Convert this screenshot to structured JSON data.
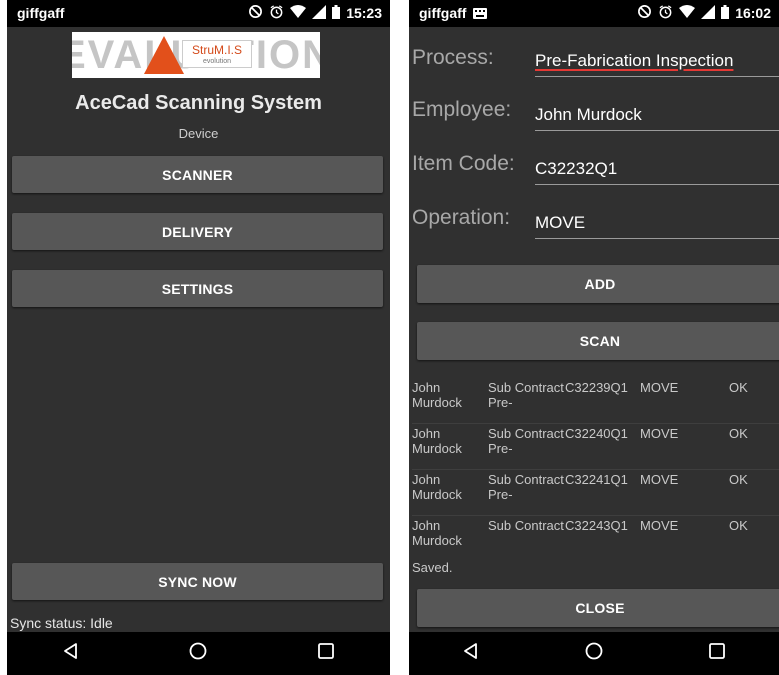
{
  "left": {
    "status": {
      "carrier": "giffgaff",
      "time": "15:23"
    },
    "logo": {
      "word": "EVALUATION",
      "brand": "StruM.I.S",
      "brand_sub": "evolution"
    },
    "title": "AceCad Scanning System",
    "device_label": "Device",
    "buttons": {
      "scanner": "SCANNER",
      "delivery": "DELIVERY",
      "settings": "SETTINGS",
      "sync": "SYNC NOW"
    },
    "sync_status": "Sync status: Idle"
  },
  "right": {
    "status": {
      "carrier": "giffgaff",
      "time": "16:02"
    },
    "form": {
      "process": {
        "label": "Process:",
        "value": "Pre-Fabrication Inspection"
      },
      "employee": {
        "label": "Employee:",
        "value": "John Murdock"
      },
      "item_code": {
        "label": "Item Code:",
        "value": "C32232Q1"
      },
      "operation": {
        "label": "Operation:",
        "value": "MOVE"
      }
    },
    "buttons": {
      "add": "ADD",
      "scan": "SCAN",
      "close": "CLOSE"
    },
    "log": [
      {
        "employee": "John Murdock",
        "process": "Sub Contract Pre-",
        "code": "C32239Q1",
        "op": "MOVE",
        "result": "OK"
      },
      {
        "employee": "John Murdock",
        "process": "Sub Contract Pre-",
        "code": "C32240Q1",
        "op": "MOVE",
        "result": "OK"
      },
      {
        "employee": "John Murdock",
        "process": "Sub Contract Pre-",
        "code": "C32241Q1",
        "op": "MOVE",
        "result": "OK"
      },
      {
        "employee": "John Murdock",
        "process": "Sub Contract",
        "code": "C32243Q1",
        "op": "MOVE",
        "result": "OK"
      }
    ],
    "saved_text": "Saved."
  },
  "icons": [
    "do-not-disturb-icon",
    "alarm-icon",
    "wifi-icon",
    "signal-icon",
    "battery-icon",
    "back-icon",
    "home-icon",
    "recents-icon",
    "keyboard-icon"
  ],
  "colors": {
    "background": "#303030",
    "button": "#575757",
    "statusbar": "#000000",
    "spellcheck": "#e53935"
  }
}
